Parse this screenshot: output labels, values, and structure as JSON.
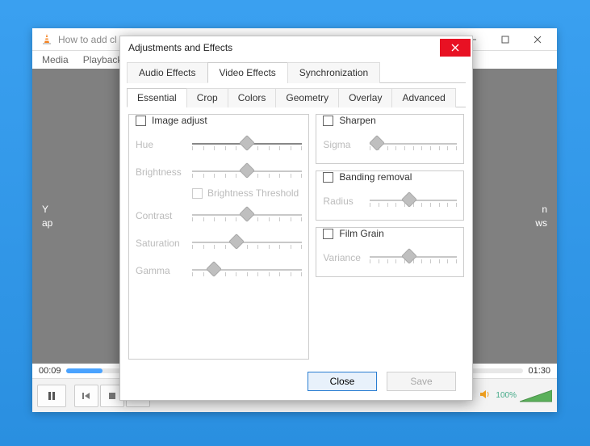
{
  "vlc": {
    "title": "How to add cl",
    "menu": {
      "media": "Media",
      "playback": "Playback"
    },
    "time": {
      "current": "00:09",
      "total": "01:30"
    },
    "volume_percent": "100%",
    "video_text_left1": "Y",
    "video_text_right1": "n",
    "video_text_left2": "ap",
    "video_text_right2": "ws"
  },
  "dialog": {
    "title": "Adjustments and Effects",
    "tabs": {
      "audio": "Audio Effects",
      "video": "Video Effects",
      "sync": "Synchronization"
    },
    "subtabs": {
      "essential": "Essential",
      "crop": "Crop",
      "colors": "Colors",
      "geometry": "Geometry",
      "overlay": "Overlay",
      "advanced": "Advanced"
    },
    "groups": {
      "image_adjust": "Image adjust",
      "sharpen": "Sharpen",
      "banding": "Banding removal",
      "film_grain": "Film Grain"
    },
    "labels": {
      "hue": "Hue",
      "brightness": "Brightness",
      "brightness_threshold": "Brightness Threshold",
      "contrast": "Contrast",
      "saturation": "Saturation",
      "gamma": "Gamma",
      "sigma": "Sigma",
      "radius": "Radius",
      "variance": "Variance"
    },
    "buttons": {
      "close": "Close",
      "save": "Save"
    }
  },
  "sliders": {
    "hue": 50,
    "brightness": 50,
    "contrast": 50,
    "saturation": 40,
    "gamma": 20,
    "sigma": 8,
    "radius": 45,
    "variance": 45
  }
}
